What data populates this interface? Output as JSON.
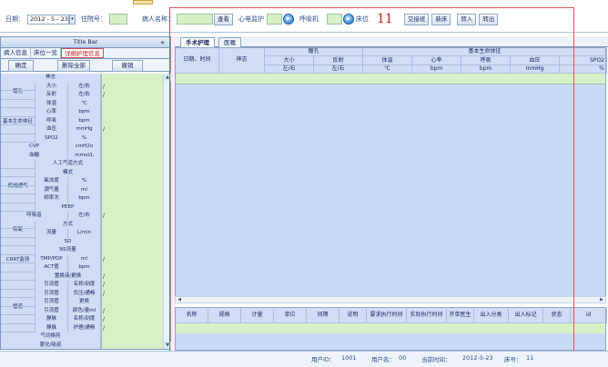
{
  "topbar": {
    "date_label": "日期：",
    "date_value": "2012 - 5 - 23",
    "inpatient_label": "住院号：",
    "patient_name_label": "病人名称：",
    "view_button": "查看",
    "ecg_label": "心电监护",
    "ventilator_label": "呼吸机",
    "bed_label": "床位",
    "bed_number": "11",
    "buttons": [
      "交接班",
      "新床",
      "转入",
      "转出"
    ]
  },
  "left_panel": {
    "title": "Title Bar",
    "collapse_icon": "«",
    "tabs": [
      "病人信息",
      "床位一览",
      "详细护理信息"
    ],
    "active_tab": 2,
    "actions": [
      "确定",
      "删除全部",
      "撤销"
    ],
    "rows": [
      {
        "group": "",
        "name": "神志",
        "unit": "",
        "value": ""
      },
      {
        "group": "瞳孔",
        "name": "大小",
        "unit": "左/右",
        "value": "/"
      },
      {
        "group": "瞳孔",
        "name": "反射",
        "unit": "左/右",
        "value": "/"
      },
      {
        "group": "基本生命体征",
        "name": "体温",
        "unit": "℃",
        "value": ""
      },
      {
        "group": "基本生命体征",
        "name": "心率",
        "unit": "bpm",
        "value": ""
      },
      {
        "group": "基本生命体征",
        "name": "呼吸",
        "unit": "bpm",
        "value": ""
      },
      {
        "group": "基本生命体征",
        "name": "血压",
        "unit": "mmHg",
        "value": "/"
      },
      {
        "group": "基本生命体征",
        "name": "SPO2",
        "unit": "%",
        "value": ""
      },
      {
        "group": "",
        "name": "CVP",
        "unit": "cmH2o",
        "value": ""
      },
      {
        "group": "",
        "name": "血糖",
        "unit": "mmol/L",
        "value": ""
      },
      {
        "group": "机械通气",
        "name": "人工气道方式",
        "unit": "",
        "value": ""
      },
      {
        "group": "机械通气",
        "name": "模式",
        "unit": "",
        "value": ""
      },
      {
        "group": "机械通气",
        "name": "氧浓度",
        "unit": "%",
        "value": ""
      },
      {
        "group": "机械通气",
        "name": "潮气量",
        "unit": "ml",
        "value": ""
      },
      {
        "group": "机械通气",
        "name": "频率次",
        "unit": "bpm",
        "value": ""
      },
      {
        "group": "机械通气",
        "name": "PEEP",
        "unit": "",
        "value": ""
      },
      {
        "group": "",
        "name": "呼吸音",
        "unit": "左/右",
        "value": "/"
      },
      {
        "group": "吸氧",
        "name": "方式",
        "unit": "",
        "value": ""
      },
      {
        "group": "吸氧",
        "name": "流量",
        "unit": "L/min",
        "value": ""
      },
      {
        "group": "CRRT监测",
        "name": "SD",
        "unit": "",
        "value": ""
      },
      {
        "group": "CRRT监测",
        "name": "NS流量",
        "unit": "",
        "value": ""
      },
      {
        "group": "CRRT监测",
        "name": "TMP/PDP",
        "unit": "ml",
        "value": "/"
      },
      {
        "group": "CRRT监测",
        "name": "ACT值",
        "unit": "bpm",
        "value": ""
      },
      {
        "group": "CRRT监测",
        "name": "置换液/更换",
        "unit": "",
        "value": "/"
      },
      {
        "group": "管道",
        "name": "引流管",
        "unit": "名称/刻度",
        "value": "/"
      },
      {
        "group": "管道",
        "name": "引流管",
        "unit": "负压/通畅",
        "value": "/"
      },
      {
        "group": "管道",
        "name": "引流管",
        "unit": "更换",
        "value": ""
      },
      {
        "group": "管道",
        "name": "引流管",
        "unit": "颜色/量ml",
        "value": "/"
      },
      {
        "group": "管道",
        "name": "静脉",
        "unit": "名称/刻度",
        "value": "/"
      },
      {
        "group": "管道",
        "name": "静脉",
        "unit": "护理/通畅",
        "value": "/"
      },
      {
        "group": "",
        "name": "气切换药",
        "unit": "",
        "value": ""
      },
      {
        "group": "",
        "name": "雾化/吸痰",
        "unit": "",
        "value": ""
      },
      {
        "group": "",
        "name": "翻身/拍背",
        "unit": "",
        "value": ""
      },
      {
        "group": "",
        "name": "口腔/会阴",
        "unit": "",
        "value": ""
      }
    ]
  },
  "right_tabs": [
    "手术护理",
    "医嘱"
  ],
  "top_grid": {
    "headers": {
      "datetime": "日期、时间",
      "consciousness": "神志",
      "pupil": "瞳孔",
      "pupil_size": "大小",
      "pupil_reflex": "反射",
      "pupil_size_unit": "左/右",
      "pupil_reflex_unit": "左/右",
      "vitals": "基本生命体征",
      "temp": "体温",
      "temp_unit": "℃",
      "hr": "心率",
      "hr_unit": "bpm",
      "resp": "呼吸",
      "resp_unit": "bpm",
      "bp": "血压",
      "bp_unit": "mmHg",
      "spo2": "SPO2",
      "spo2_unit": "%"
    }
  },
  "bottom_grid": {
    "headers": [
      "名称",
      "规格",
      "计量",
      "单位",
      "间隔",
      "说明",
      "要求执行时间",
      "实际执行时间",
      "开单医生",
      "出入分类",
      "出入标记",
      "状态",
      "id"
    ]
  },
  "status_bar": {
    "user_id_label": "用户ID：",
    "user_id": "1001",
    "user_name_label": "用户名：",
    "user_name": "00",
    "date_label": "当前时间：",
    "date": "2012-5-23",
    "bed_label": "床号：",
    "bed": "11"
  }
}
